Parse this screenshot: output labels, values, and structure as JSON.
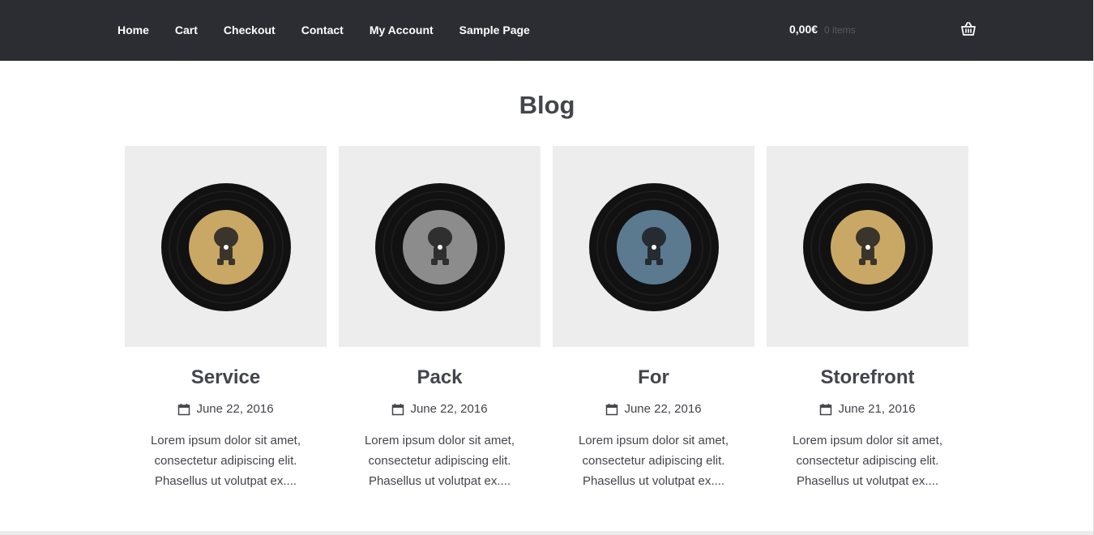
{
  "nav": {
    "items": [
      "Home",
      "Cart",
      "Checkout",
      "Contact",
      "My Account",
      "Sample Page"
    ]
  },
  "cart": {
    "amount": "0,00€",
    "count": "0 items",
    "icon": "basket-icon"
  },
  "page": {
    "title": "Blog"
  },
  "posts": [
    {
      "title": "Service",
      "date": "June 22, 2016",
      "excerpt": [
        "Lorem ipsum dolor sit amet,",
        "consectetur adipiscing elit.",
        "Phasellus ut volutpat ex...."
      ],
      "label_color": "#c9a865"
    },
    {
      "title": "Pack",
      "date": "June 22, 2016",
      "excerpt": [
        "Lorem ipsum dolor sit amet,",
        "consectetur adipiscing elit.",
        "Phasellus ut volutpat ex...."
      ],
      "label_color": "#8c8c8c"
    },
    {
      "title": "For",
      "date": "June 22, 2016",
      "excerpt": [
        "Lorem ipsum dolor sit amet,",
        "consectetur adipiscing elit.",
        "Phasellus ut volutpat ex...."
      ],
      "label_color": "#5b7a90"
    },
    {
      "title": "Storefront",
      "date": "June 21, 2016",
      "excerpt": [
        "Lorem ipsum dolor sit amet,",
        "consectetur adipiscing elit.",
        "Phasellus ut volutpat ex...."
      ],
      "label_color": "#c9a865"
    }
  ],
  "colors": {
    "header_bg": "#2c2d33",
    "thumb_bg": "#ededed",
    "text": "#43454b"
  }
}
